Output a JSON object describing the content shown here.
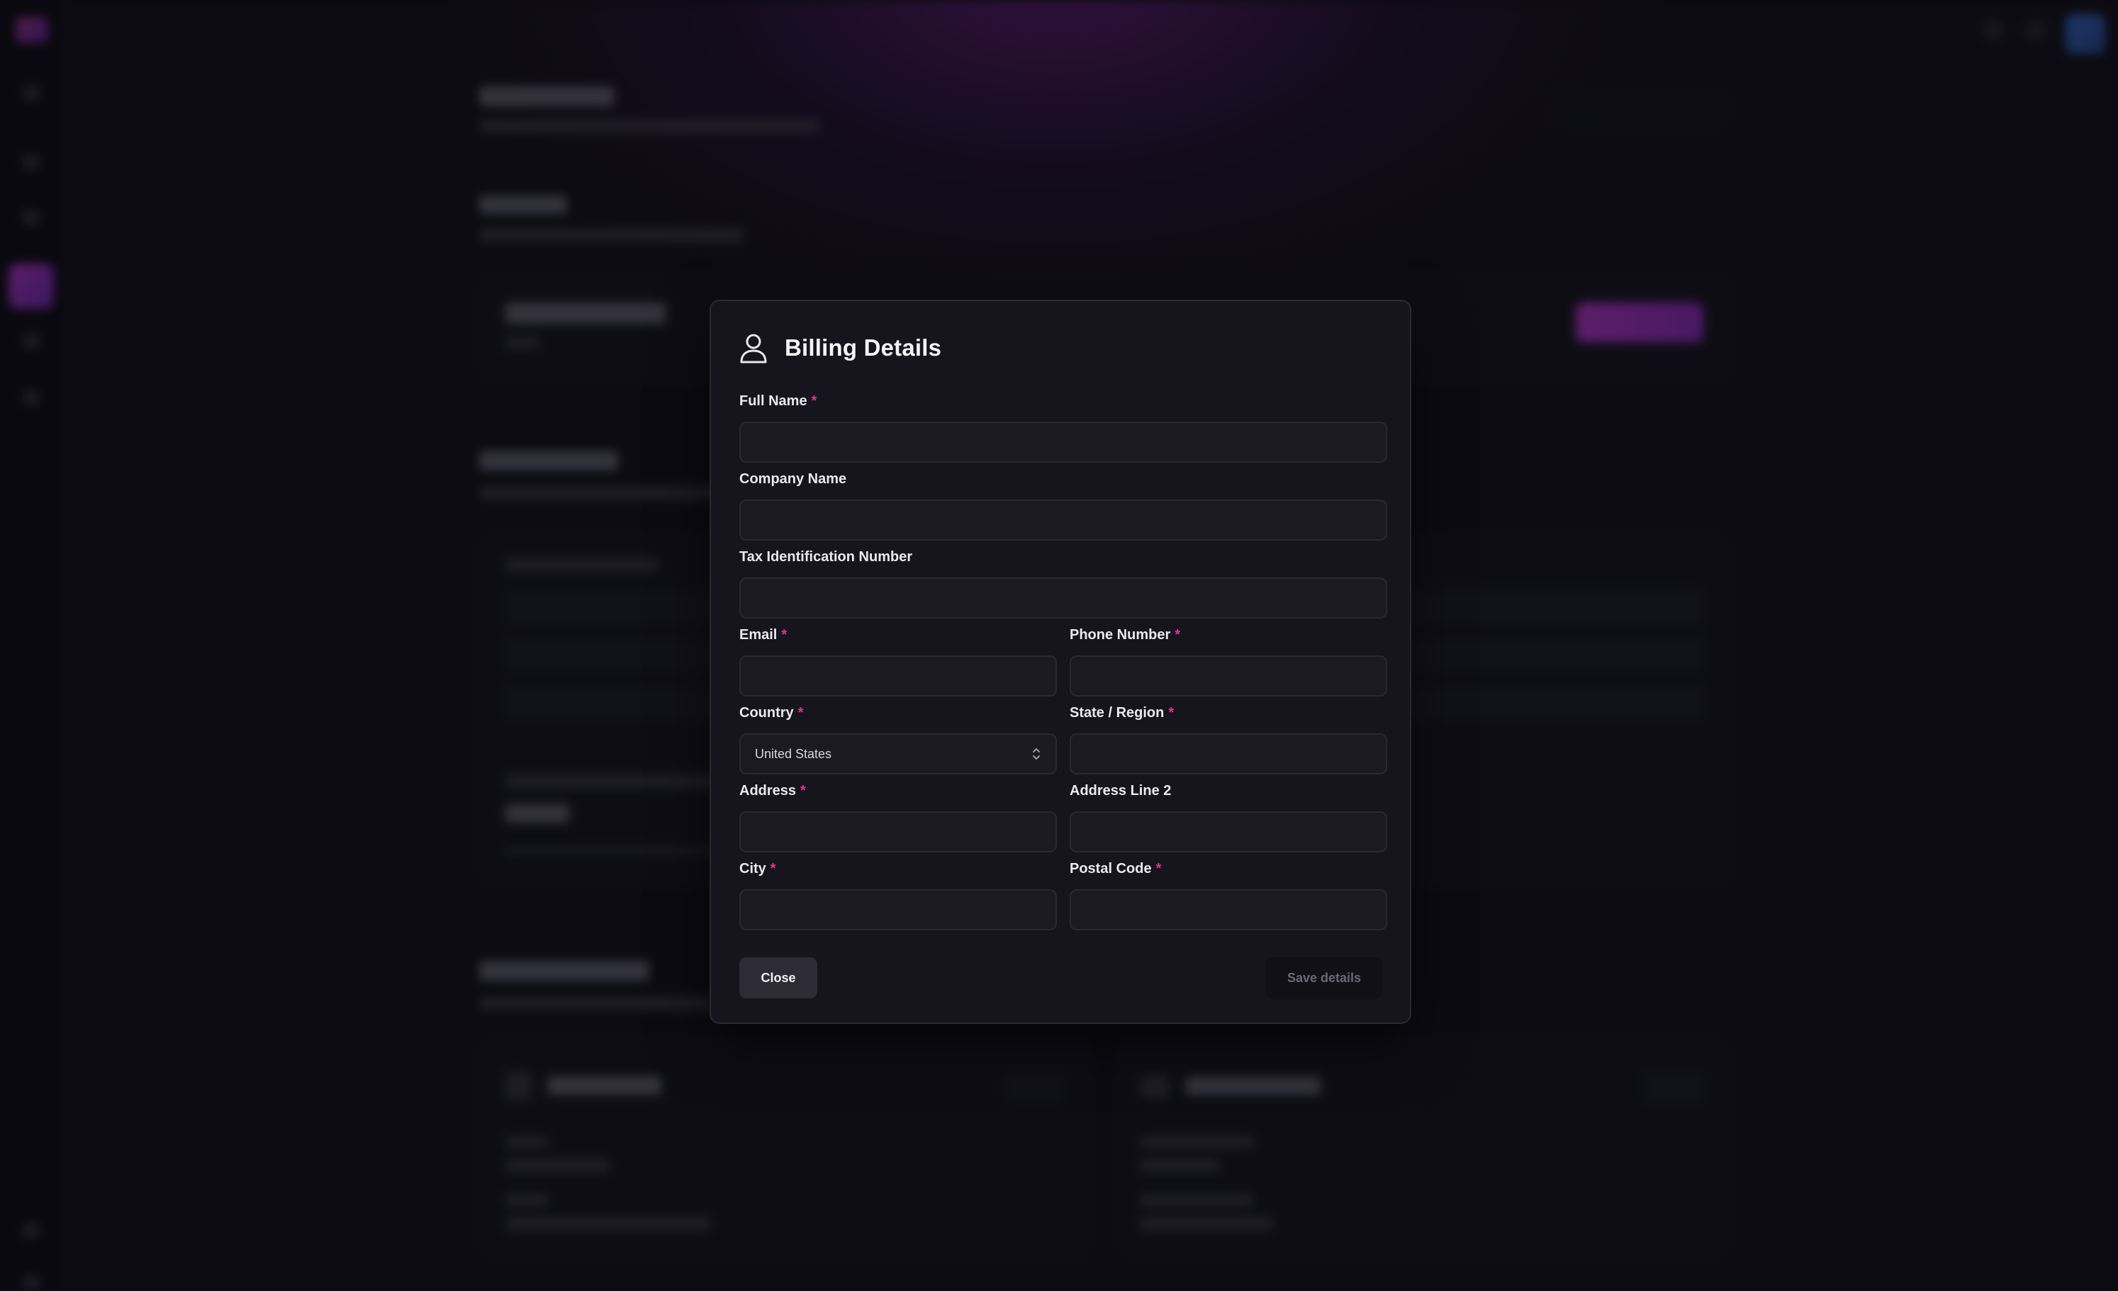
{
  "background": {
    "accent_color": "#c43ad8",
    "page_bg": "#121119",
    "sidebar_icons": [
      "logo-icon",
      "home-icon",
      "grid-icon",
      "layers-icon",
      "billing-icon",
      "chart-icon",
      "settings-icon"
    ]
  },
  "modal": {
    "title": "Billing Details",
    "icon": "user-icon",
    "required_color": "#e2348f",
    "fields": {
      "full_name": {
        "label": "Full Name",
        "required": "*",
        "value": ""
      },
      "company_name": {
        "label": "Company Name",
        "value": ""
      },
      "tax_id": {
        "label": "Tax Identification Number",
        "value": ""
      },
      "email": {
        "label": "Email",
        "required": "*",
        "value": ""
      },
      "phone": {
        "label": "Phone Number",
        "required": "*",
        "value": ""
      },
      "country": {
        "label": "Country",
        "required": "*",
        "value": "United States"
      },
      "state": {
        "label": "State / Region",
        "required": "*",
        "value": ""
      },
      "address": {
        "label": "Address",
        "required": "*",
        "value": ""
      },
      "address2": {
        "label": "Address Line 2",
        "value": ""
      },
      "city": {
        "label": "City",
        "required": "*",
        "value": ""
      },
      "postal_code": {
        "label": "Postal Code",
        "required": "*",
        "value": ""
      }
    },
    "buttons": {
      "close": "Close",
      "save": "Save details"
    }
  }
}
